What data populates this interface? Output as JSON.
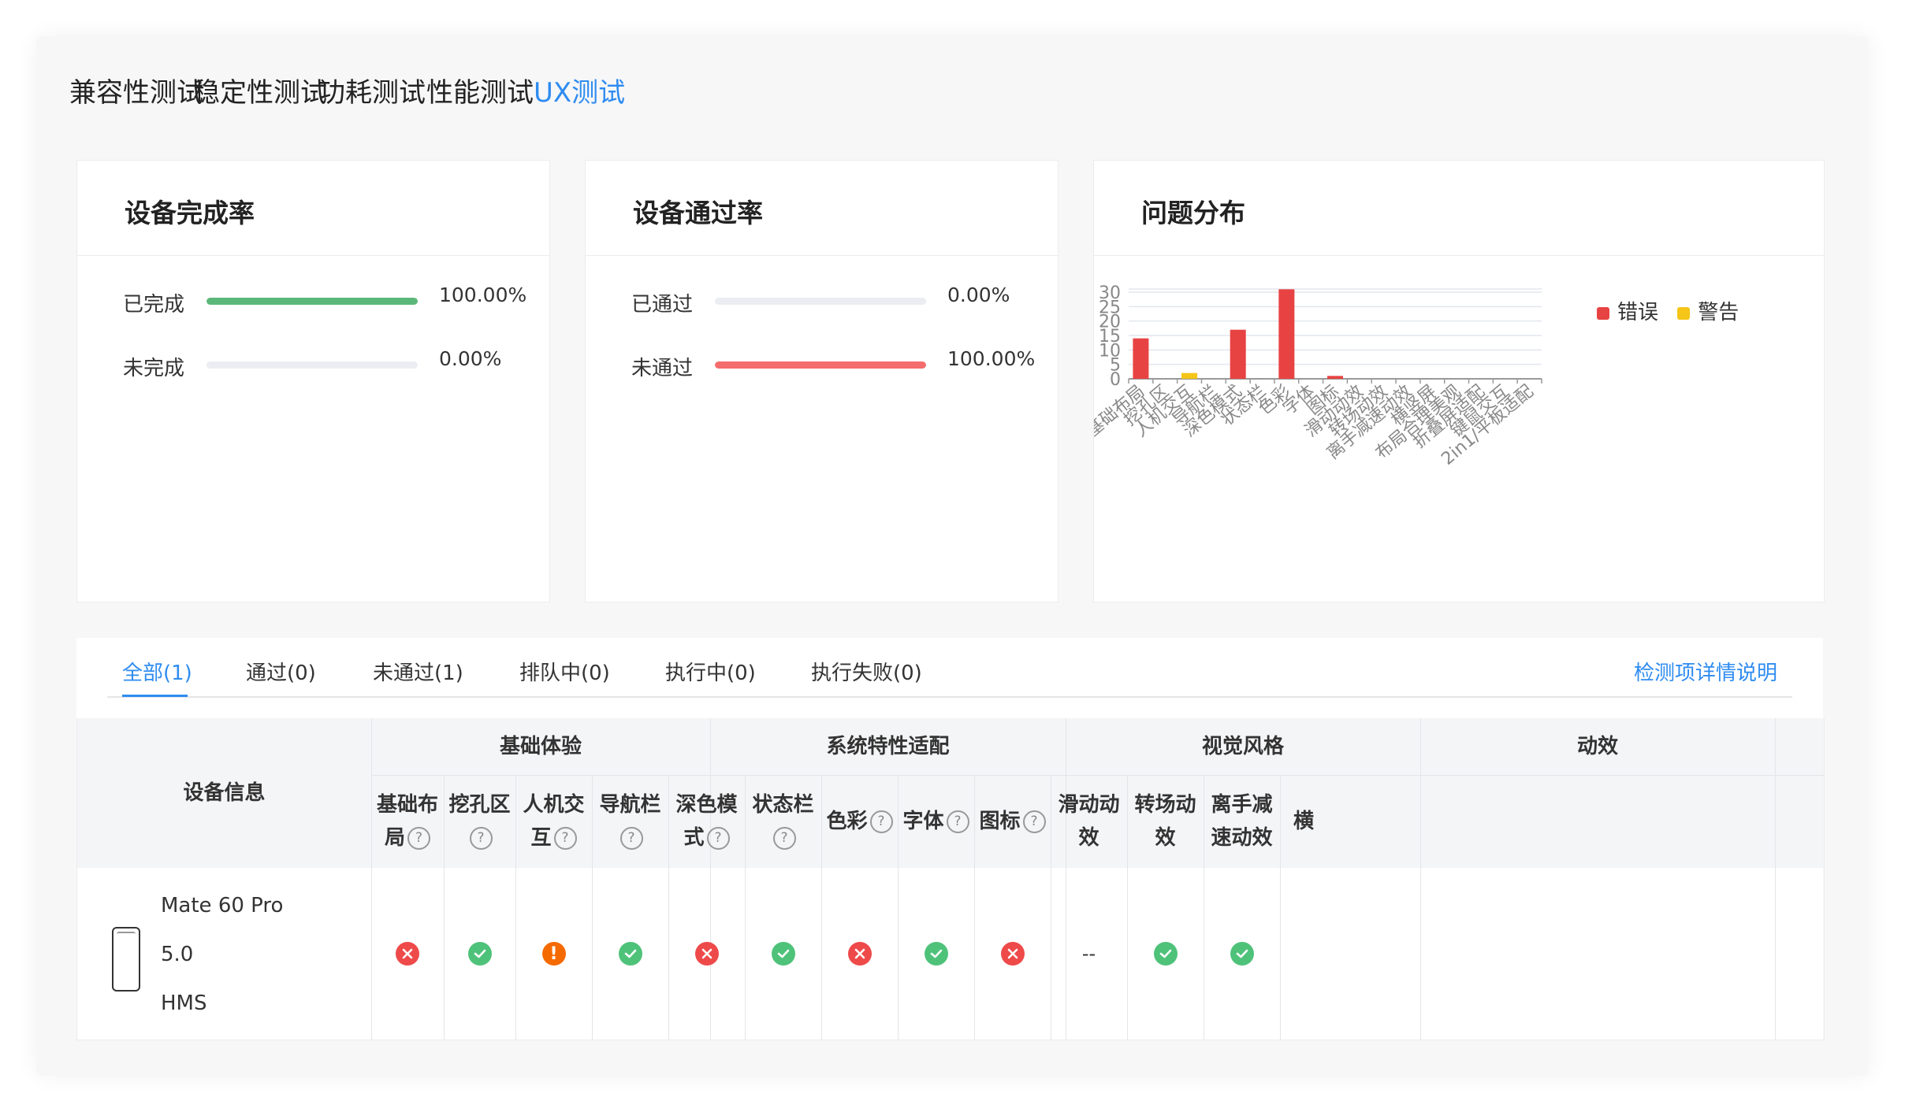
{
  "main_tabs": [
    {
      "label": "兼容性测试",
      "active": false
    },
    {
      "label": "稳定性测试",
      "active": false
    },
    {
      "label": "功耗测试",
      "active": false
    },
    {
      "label": "性能测试",
      "active": false
    },
    {
      "label": "UX测试",
      "active": true
    }
  ],
  "completion_card": {
    "title": "设备完成率",
    "rows": [
      {
        "label": "已完成",
        "value_text": "100.00%",
        "fraction": 1.0,
        "color": "#5cb87a"
      },
      {
        "label": "未完成",
        "value_text": "0.00%",
        "fraction": 0.0,
        "color": "#5cb87a"
      }
    ]
  },
  "pass_card": {
    "title": "设备通过率",
    "rows": [
      {
        "label": "已通过",
        "value_text": "0.00%",
        "fraction": 0.0,
        "color": "#f56c6c"
      },
      {
        "label": "未通过",
        "value_text": "100.00%",
        "fraction": 1.0,
        "color": "#f56c6c"
      }
    ]
  },
  "issue_card": {
    "title": "问题分布"
  },
  "chart_data": {
    "type": "bar",
    "categories": [
      "基础布局",
      "挖孔区",
      "人机交互",
      "导航栏",
      "深色模式",
      "状态栏",
      "色彩",
      "字体",
      "图标",
      "滑动动效",
      "转场动效",
      "离手减速动效",
      "横竖屏",
      "布局合理美观",
      "折叠屏适配",
      "键鼠交互",
      "2in1/平板适配"
    ],
    "series": [
      {
        "name": "错误",
        "color": "#e84343",
        "values": [
          14,
          0,
          0,
          0,
          17,
          0,
          31,
          0,
          1,
          0,
          0,
          0,
          0,
          0,
          0,
          0,
          0
        ]
      },
      {
        "name": "警告",
        "color": "#f5c518",
        "values": [
          0,
          0,
          2,
          0,
          0,
          0,
          0,
          0,
          0,
          0,
          0,
          0,
          0,
          0,
          0,
          0,
          0
        ]
      }
    ],
    "yticks": [
      "0",
      "5",
      "10",
      "15",
      "20",
      "25",
      "30"
    ],
    "ylim": [
      0,
      31
    ],
    "legend_position": "top-right",
    "grid": true
  },
  "sub_tabs": [
    {
      "label": "全部(1)",
      "active": true
    },
    {
      "label": "通过(0)",
      "active": false
    },
    {
      "label": "未通过(1)",
      "active": false
    },
    {
      "label": "排队中(0)",
      "active": false
    },
    {
      "label": "执行中(0)",
      "active": false
    },
    {
      "label": "执行失败(0)",
      "active": false
    }
  ],
  "detail_link": "检测项详情说明",
  "table": {
    "device_header": "设备信息",
    "groups": [
      "基础体验",
      "系统特性适配",
      "视觉风格",
      "动效"
    ],
    "columns": [
      {
        "line1": "基础布",
        "line2": "局",
        "help": true,
        "status": "error"
      },
      {
        "line1": "挖孔区",
        "line2": "",
        "help": true,
        "status": "pass"
      },
      {
        "line1": "人机交",
        "line2": "互",
        "help": true,
        "status": "warn"
      },
      {
        "line1": "导航栏",
        "line2": "",
        "help": true,
        "status": "pass"
      },
      {
        "line1": "深色模",
        "line2": "式",
        "help": true,
        "status": "error"
      },
      {
        "line1": "状态栏",
        "line2": "",
        "help": true,
        "status": "pass"
      },
      {
        "line1": "色彩",
        "line2": "",
        "help": true,
        "status": "error"
      },
      {
        "line1": "字体",
        "line2": "",
        "help": true,
        "status": "pass"
      },
      {
        "line1": "图标",
        "line2": "",
        "help": true,
        "status": "error"
      },
      {
        "line1": "滑动动",
        "line2": "效",
        "help": false,
        "status": "none"
      },
      {
        "line1": "转场动",
        "line2": "效",
        "help": false,
        "status": "pass"
      },
      {
        "line1": "离手减",
        "line2": "速动效",
        "help": false,
        "status": "pass"
      },
      {
        "line1": "横",
        "line2": "",
        "help": false,
        "status": "none"
      }
    ],
    "device": {
      "model": "Mate 60 Pro",
      "version": "5.0",
      "os": "HMS"
    },
    "missing_value": "--",
    "warn_glyph": "!",
    "help_glyph": "?"
  }
}
